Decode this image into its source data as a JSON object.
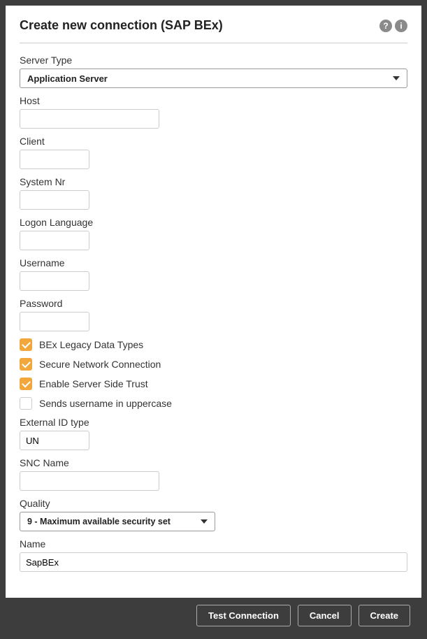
{
  "dialog": {
    "title": "Create new connection (SAP BEx)"
  },
  "fields": {
    "server_type": {
      "label": "Server Type",
      "value": "Application Server"
    },
    "host": {
      "label": "Host",
      "value": ""
    },
    "client": {
      "label": "Client",
      "value": ""
    },
    "system_nr": {
      "label": "System Nr",
      "value": ""
    },
    "logon_language": {
      "label": "Logon Language",
      "value": ""
    },
    "username": {
      "label": "Username",
      "value": ""
    },
    "password": {
      "label": "Password",
      "value": ""
    },
    "external_id_type": {
      "label": "External ID type",
      "value": "UN"
    },
    "snc_name": {
      "label": "SNC Name",
      "value": ""
    },
    "quality": {
      "label": "Quality",
      "value": "9 - Maximum available security set"
    },
    "name": {
      "label": "Name",
      "value": "SapBEx"
    }
  },
  "checkboxes": {
    "bex_legacy": {
      "label": "BEx Legacy Data Types",
      "checked": true
    },
    "snc": {
      "label": "Secure Network Connection",
      "checked": true
    },
    "server_side_trust": {
      "label": "Enable Server Side Trust",
      "checked": true
    },
    "uppercase_username": {
      "label": "Sends username in uppercase",
      "checked": false
    }
  },
  "buttons": {
    "test": "Test Connection",
    "cancel": "Cancel",
    "create": "Create"
  }
}
